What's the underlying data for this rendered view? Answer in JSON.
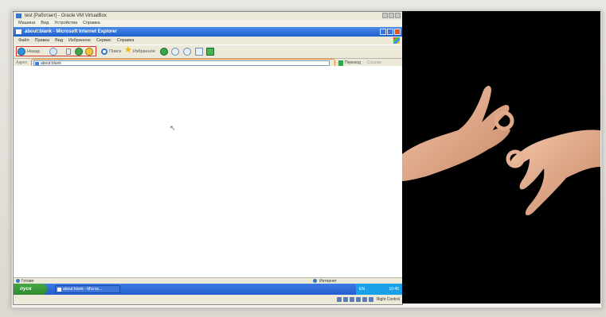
{
  "virtualbox": {
    "title": "test [Работает] - Oracle VM VirtualBox",
    "menu": [
      "Машина",
      "Вид",
      "Устройства",
      "Справка"
    ],
    "host_key": "Right Control"
  },
  "ie": {
    "title": "about:blank - Microsoft Internet Explorer",
    "menu": [
      "Файл",
      "Правка",
      "Вид",
      "Избранное",
      "Сервис",
      "Справка"
    ],
    "toolbar": {
      "back_label": "Назад",
      "search_label": "Поиск",
      "favorites_label": "Избранное"
    },
    "address": {
      "label": "Адрес",
      "value": "about:blank",
      "go_label": "Переход",
      "links_label": "Ссылки"
    },
    "status": {
      "left": "Готово",
      "zone": "Интернет"
    }
  },
  "taskbar": {
    "start_label": "пуск",
    "task_label": "about:blank - Micros...",
    "tray_lang": "EN",
    "tray_time": "10:45"
  },
  "colors": {
    "toolbar_highlight": "#d7342c",
    "address_highlight": "#f08c2e",
    "ie_title": "#1f5fcf",
    "signer_bg": "#000000"
  }
}
